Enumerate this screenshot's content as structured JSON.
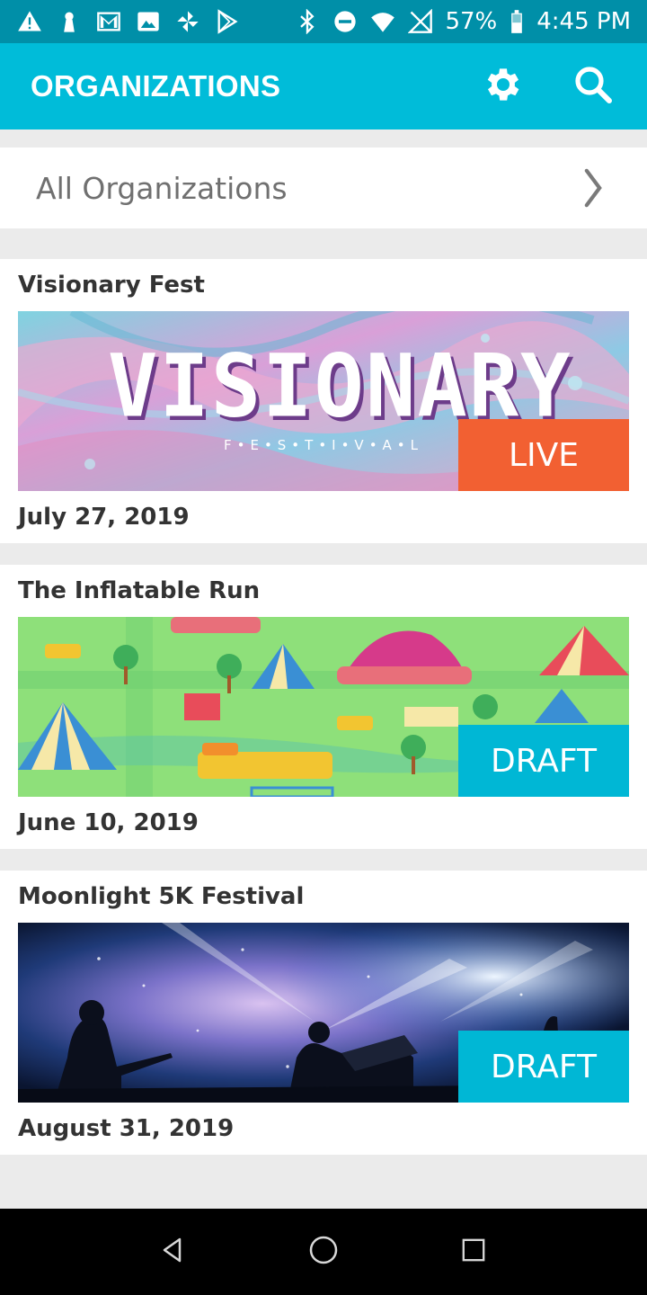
{
  "status_bar": {
    "battery": "57%",
    "time": "4:45 PM",
    "left_icons": [
      "alert-icon",
      "keyhole-icon",
      "gmail-icon",
      "image-icon",
      "pinwheel-icon",
      "play-store-icon"
    ],
    "right_icons": [
      "bluetooth-icon",
      "do-not-disturb-icon",
      "wifi-icon",
      "no-signal-icon",
      "battery-icon"
    ]
  },
  "app_bar": {
    "title": "ORGANIZATIONS",
    "actions": [
      "gear-icon",
      "search-icon"
    ]
  },
  "selector": {
    "label": "All Organizations",
    "icon": "chevron-right-icon"
  },
  "events": [
    {
      "title": "Visionary Fest",
      "date": "July 27, 2019",
      "status": "LIVE",
      "banner_text": "VISIONARY",
      "banner_subtext": "F•E•S•T•I•V•A•L"
    },
    {
      "title": "The Inflatable Run",
      "date": "June 10, 2019",
      "status": "DRAFT"
    },
    {
      "title": "Moonlight 5K Festival",
      "date": "August 31, 2019",
      "status": "DRAFT"
    }
  ],
  "nav_bar": {
    "buttons": [
      "back-icon",
      "home-icon",
      "recents-icon"
    ]
  },
  "colors": {
    "status_bar": "#008fa8",
    "app_bar": "#00bcd9",
    "live_badge": "#f26032",
    "draft_badge": "#00b7d5",
    "background": "#ebebeb"
  }
}
